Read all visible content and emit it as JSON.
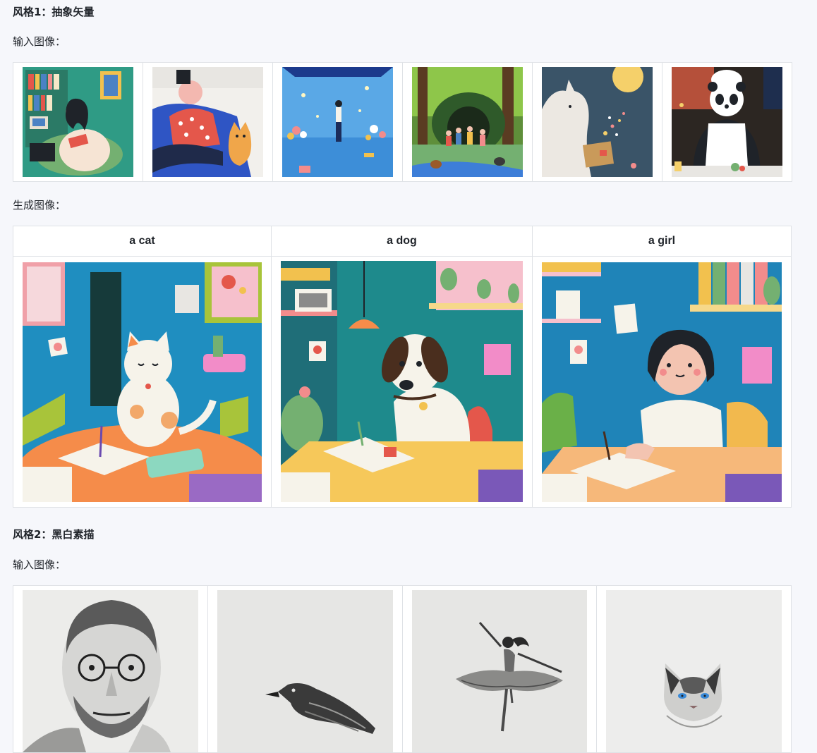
{
  "style1": {
    "heading": "风格1：抽象矢量",
    "input_label": "输入图像：",
    "input_images": [
      {
        "icon": "reading-woman-illustration"
      },
      {
        "icon": "man-sofa-cat-illustration"
      },
      {
        "icon": "figure-blue-room-illustration"
      },
      {
        "icon": "children-forest-illustration"
      },
      {
        "icon": "moomin-box-illustration"
      },
      {
        "icon": "panda-chef-illustration"
      }
    ],
    "output_label": "生成图像：",
    "outputs": [
      {
        "prompt": "a cat",
        "icon": "cat-desk-illustration"
      },
      {
        "prompt": "a dog",
        "icon": "dog-desk-illustration"
      },
      {
        "prompt": "a girl",
        "icon": "girl-desk-illustration"
      }
    ]
  },
  "style2": {
    "heading": "风格2：黑白素描",
    "input_label": "输入图像：",
    "input_images": [
      {
        "icon": "man-portrait-sketch"
      },
      {
        "icon": "crow-sketch"
      },
      {
        "icon": "ballerina-sketch"
      },
      {
        "icon": "cat-sketch"
      }
    ]
  }
}
